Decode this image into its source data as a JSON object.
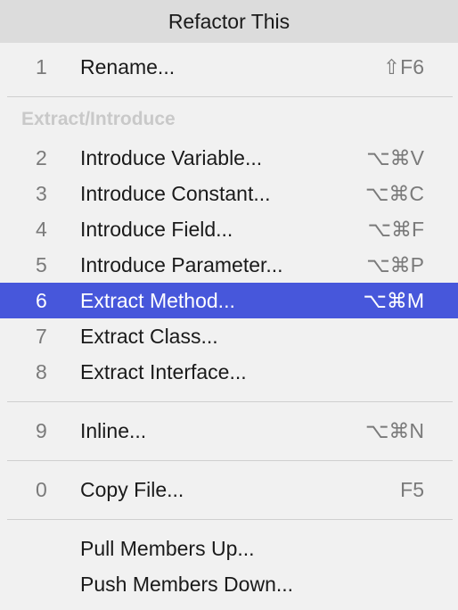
{
  "popup": {
    "title": "Refactor This"
  },
  "items": [
    {
      "num": "1",
      "label": "Rename...",
      "shortcut": "⇧F6"
    },
    {
      "num": "2",
      "label": "Introduce Variable...",
      "shortcut": "⌥⌘V"
    },
    {
      "num": "3",
      "label": "Introduce Constant...",
      "shortcut": "⌥⌘C"
    },
    {
      "num": "4",
      "label": "Introduce Field...",
      "shortcut": "⌥⌘F"
    },
    {
      "num": "5",
      "label": "Introduce Parameter...",
      "shortcut": "⌥⌘P"
    },
    {
      "num": "6",
      "label": "Extract Method...",
      "shortcut": "⌥⌘M",
      "selected": true
    },
    {
      "num": "7",
      "label": "Extract Class...",
      "shortcut": ""
    },
    {
      "num": "8",
      "label": "Extract Interface...",
      "shortcut": ""
    },
    {
      "num": "9",
      "label": "Inline...",
      "shortcut": "⌥⌘N"
    },
    {
      "num": "0",
      "label": "Copy File...",
      "shortcut": "F5"
    },
    {
      "num": "",
      "label": "Pull Members Up...",
      "shortcut": ""
    },
    {
      "num": "",
      "label": "Push Members Down...",
      "shortcut": ""
    }
  ],
  "groups": {
    "extract_introduce": "Extract/Introduce"
  },
  "colors": {
    "selection": "#4757db",
    "background": "#f1f1f1",
    "title_bg": "#dcdcdc"
  }
}
